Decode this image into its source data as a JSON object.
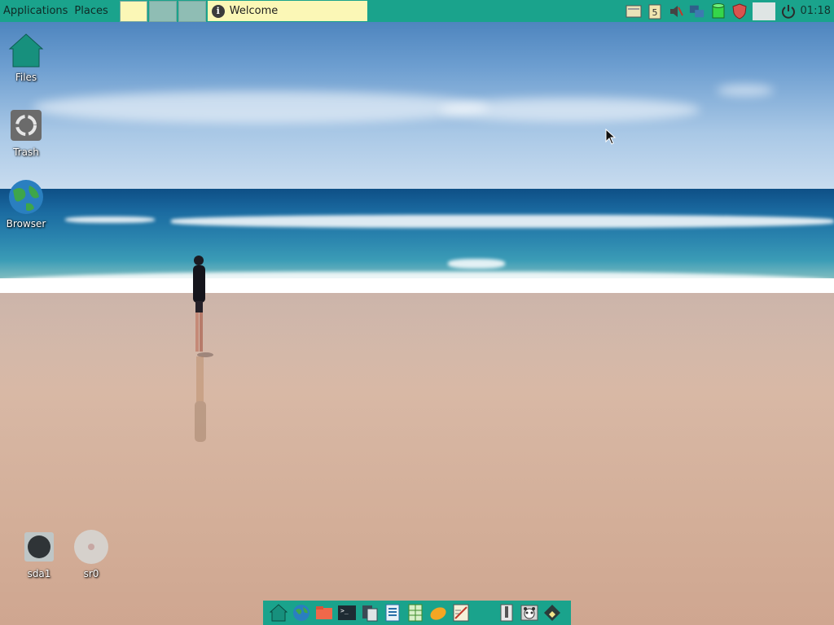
{
  "top_panel": {
    "menus": [
      "Applications",
      "Places"
    ],
    "task": {
      "title": "Welcome",
      "icon": "info-icon"
    },
    "tray_icons": [
      "file-manager-tray-icon",
      "clipboard-icon",
      "volume-muted-icon",
      "network-icon",
      "database-icon",
      "shield-icon",
      "blank-tray-icon",
      "power-icon"
    ],
    "clock": "01:18",
    "colors": {
      "panel": "#1aa38c",
      "task_bg": "#fbf7b6"
    }
  },
  "desktop": {
    "icons": [
      {
        "label": "Files",
        "icon": "home-folder-icon"
      },
      {
        "label": "Trash",
        "icon": "trash-icon"
      },
      {
        "label": "Browser",
        "icon": "globe-icon"
      },
      {
        "label": "sda1",
        "icon": "hard-drive-icon"
      },
      {
        "label": "sr0",
        "icon": "optical-disc-icon"
      }
    ]
  },
  "dock": {
    "items": [
      "home-icon",
      "browser-icon",
      "folder-icon",
      "terminal-icon",
      "file-manager-icon",
      "document-icon",
      "spreadsheet-icon",
      "mango-icon",
      "text-editor-icon",
      "spacer",
      "usb-icon",
      "panda-icon",
      "app-installer-icon"
    ]
  }
}
